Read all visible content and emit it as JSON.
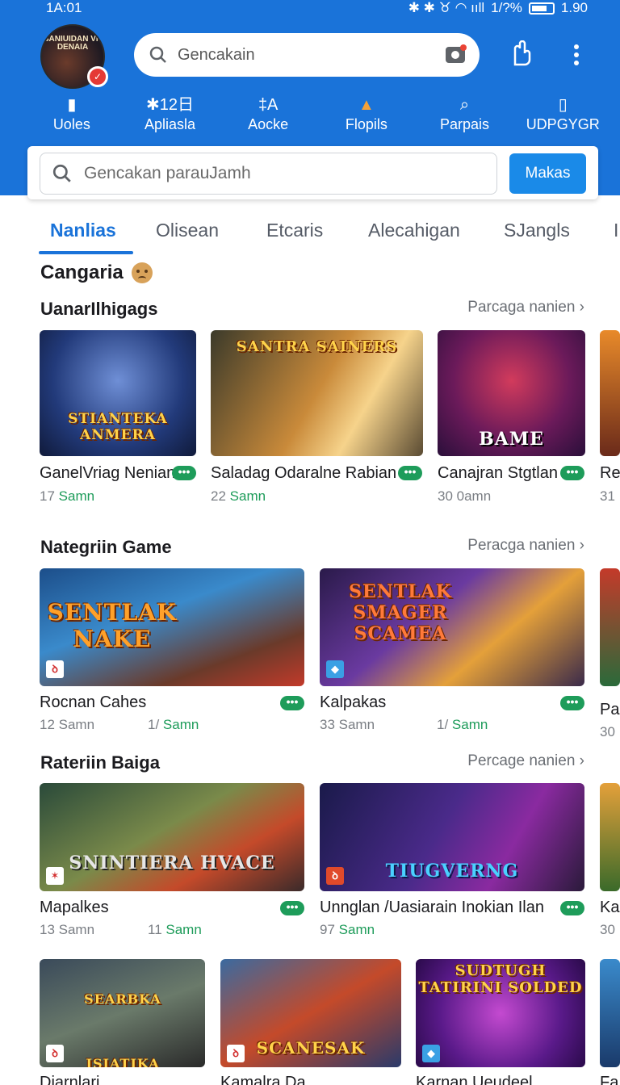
{
  "status": {
    "time": "1A:01",
    "icons": "✱ ✱ ♉ ◠ ııll",
    "battery_pct": "1/?%",
    "battery_extra": "1.90"
  },
  "profile": {
    "avatar_text": "SANIUIDAN VN DENAIA",
    "badge": "✓"
  },
  "top_search": {
    "placeholder": "Gencakain"
  },
  "quick_nav": [
    {
      "icon": "▮",
      "label": "Uoles"
    },
    {
      "icon": "✱12日",
      "label": "Apliasla"
    },
    {
      "icon": "‡A",
      "label": "Aocke"
    },
    {
      "icon": "▲",
      "label": "Flopils"
    },
    {
      "icon": "⌕",
      "label": "Parpais"
    },
    {
      "icon": "▯",
      "label": "UDPGYGR"
    }
  ],
  "search": {
    "placeholder": "Gencakan parauJamh",
    "button": "Makas"
  },
  "tabs": [
    "Nanlias",
    "Olisean",
    "Etcaris",
    "Alecahigan",
    "SJangls",
    "I"
  ],
  "category_title": "Cangaria",
  "sections": [
    {
      "title": "UanarIlhigags",
      "see_more": "Parcaga nanien",
      "cards": [
        {
          "name": "GanelVriag Nenian",
          "meta_a": "17",
          "meta_b": "Samn",
          "art": "STIANTEKA ANMERA"
        },
        {
          "name": "Saladag Odaralne Rabian",
          "meta_a": "22",
          "meta_b": "Samn",
          "art": "SANTRA SAINERS"
        },
        {
          "name": "Canajran Stgtlan",
          "meta_a": "30 0amn",
          "meta_b": "",
          "art": "BAME"
        },
        {
          "name": "Re",
          "meta_a": "31",
          "meta_b": "",
          "art": ""
        }
      ]
    },
    {
      "title": "Nategriin Game",
      "see_more": "Peracga nanien",
      "cards": [
        {
          "name": "Rocnan Cahes",
          "meta_a": "12 Samn",
          "meta_c": "1/",
          "meta_b": "Samn",
          "art": "SENTLAK NAKE"
        },
        {
          "name": "Kalpakas",
          "meta_a": "33 Samn",
          "meta_c": "1/",
          "meta_b": "Samn",
          "art": "SENTLAK SMAGER SCAMEA"
        },
        {
          "name": "Pa",
          "meta_a": "30",
          "art": ""
        }
      ]
    },
    {
      "title": "Rateriin Baiga",
      "see_more": "Percage nanien",
      "cards": [
        {
          "name": "Mapalkes",
          "meta_a": "13 Samn",
          "meta_c": "11",
          "meta_b": "Samn",
          "art": "SNINTIERA HVACE"
        },
        {
          "name": "Unnglan /Uasiarain Inokian Ilan",
          "meta_a": "97",
          "meta_b": "Samn",
          "art": "TIUGVERNG"
        },
        {
          "name": "Ka",
          "meta_a": "30",
          "art": ""
        }
      ]
    }
  ],
  "bottom_row": [
    {
      "name": "Diarnlari",
      "art": "SEARBKA JSIATIKA"
    },
    {
      "name": "Kamalra Da",
      "art": "SCANESAK"
    },
    {
      "name": "Karnan Ueudeel",
      "art": "SUDTUGH TATIRINI SOLDED"
    },
    {
      "name": "Fa",
      "art": ""
    }
  ],
  "colors": {
    "header_blue": "#1a73d9",
    "accent_green": "#1e9c5a",
    "button_blue": "#1a8ae8"
  }
}
